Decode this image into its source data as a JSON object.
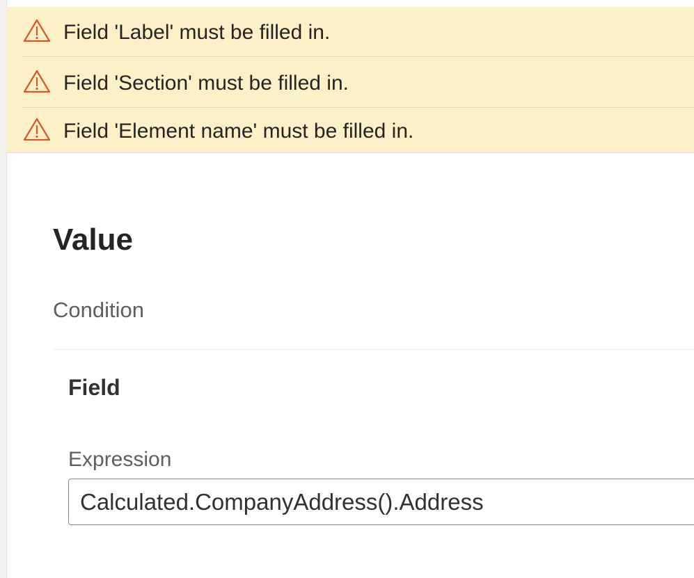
{
  "notifications": [
    {
      "icon": "warning-triangle-icon",
      "text": "Field 'Label' must be filled in."
    },
    {
      "icon": "warning-triangle-icon",
      "text": "Field 'Section' must be filled in."
    },
    {
      "icon": "warning-triangle-icon",
      "text": "Field 'Element name' must be filled in."
    }
  ],
  "panel": {
    "title": "Value",
    "condition_label": "Condition",
    "field_heading": "Field",
    "expression": {
      "label": "Expression",
      "value": "Calculated.CompanyAddress().Address"
    }
  },
  "colors": {
    "notification_background": "#fbf0c7",
    "warning_icon": "#d9542b",
    "text": "#252423"
  }
}
